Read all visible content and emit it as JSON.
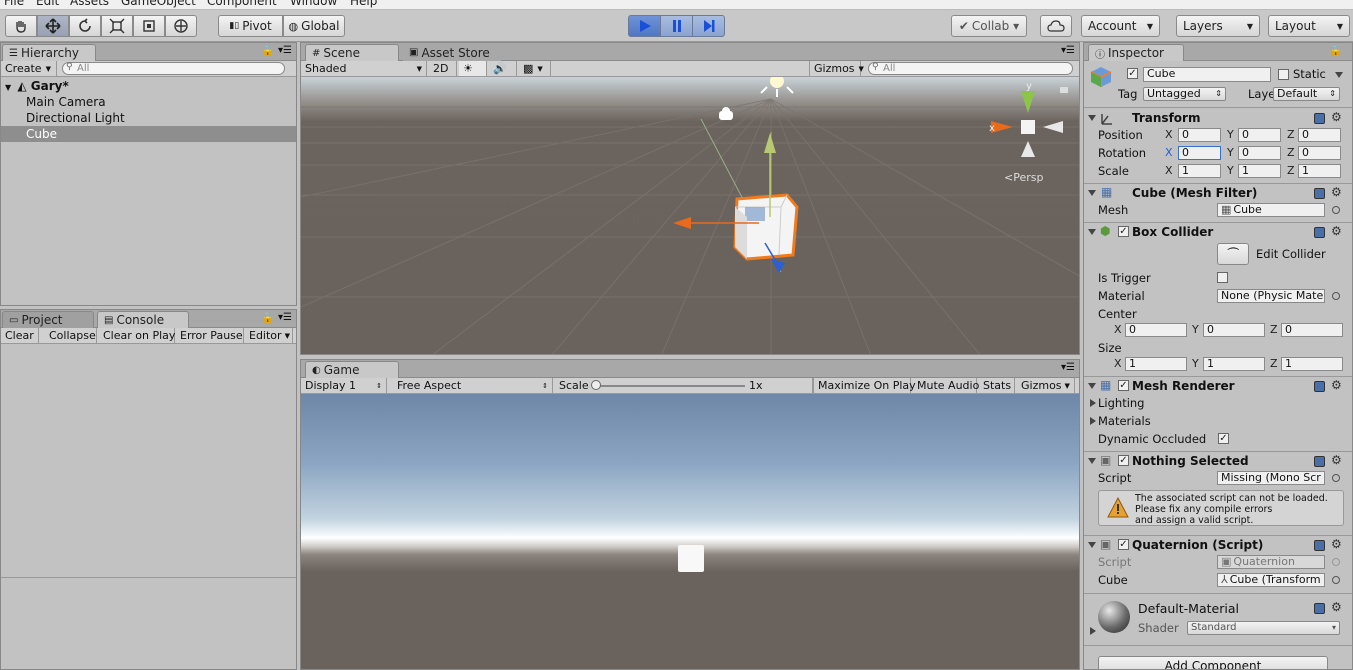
{
  "menu": [
    "File",
    "Edit",
    "Assets",
    "GameObject",
    "Component",
    "Window",
    "Help"
  ],
  "toolbar": {
    "pivot": "Pivot",
    "global": "Global",
    "collab": "Collab ▾",
    "account": "Account",
    "layers": "Layers",
    "layout": "Layout"
  },
  "hierarchy": {
    "tab": "Hierarchy",
    "create": "Create",
    "search_placeholder": "All",
    "scene": "Gary*",
    "items": [
      "Main Camera",
      "Directional Light",
      "Cube"
    ]
  },
  "scene": {
    "tab": "Scene",
    "asset_tab": "Asset Store",
    "shaded": "Shaded",
    "mode2d": "2D",
    "gizmos": "Gizmos",
    "search_placeholder": "All",
    "persp": "Persp",
    "axis_x": "x",
    "axis_y": "y"
  },
  "project": {
    "tab": "Project",
    "console_tab": "Console",
    "buttons": [
      "Clear",
      "Collapse",
      "Clear on Play",
      "Error Pause",
      "Editor"
    ]
  },
  "game": {
    "tab": "Game",
    "display": "Display 1",
    "aspect": "Free Aspect",
    "scale_label": "Scale",
    "scale_value": "1x",
    "maximize": "Maximize On Play",
    "mute": "Mute Audio",
    "stats": "Stats",
    "gizmos": "Gizmos"
  },
  "inspector": {
    "tab": "Inspector",
    "name": "Cube",
    "static": "Static",
    "tag_label": "Tag",
    "tag": "Untagged",
    "layer_label": "Layer",
    "layer": "Default",
    "transform": {
      "title": "Transform",
      "position_label": "Position",
      "rotation_label": "Rotation",
      "scale_label": "Scale",
      "position": [
        "0",
        "0",
        "0"
      ],
      "rotation": [
        "0",
        "0",
        "0"
      ],
      "scale": [
        "1",
        "1",
        "1"
      ]
    },
    "axes": [
      "X",
      "Y",
      "Z"
    ],
    "mesh_filter": {
      "title": "Cube (Mesh Filter)",
      "mesh_label": "Mesh",
      "mesh": "Cube"
    },
    "box_collider": {
      "title": "Box Collider",
      "edit": "Edit Collider",
      "trigger_label": "Is Trigger",
      "material_label": "Material",
      "material": "None (Physic Mate",
      "center_label": "Center",
      "size_label": "Size",
      "center": [
        "0",
        "0",
        "0"
      ],
      "size": [
        "1",
        "1",
        "1"
      ]
    },
    "mesh_renderer": {
      "title": "Mesh Renderer",
      "lighting": "Lighting",
      "materials": "Materials",
      "dynamic": "Dynamic Occluded"
    },
    "nothing": {
      "title": "Nothing Selected",
      "script_label": "Script",
      "script": "Missing (Mono Scr",
      "warning": "The associated script can not be loaded.\nPlease fix any compile errors\nand assign a valid script."
    },
    "quaternion": {
      "title": "Quaternion (Script)",
      "script_label": "Script",
      "script": "Quaternion",
      "cube_label": "Cube",
      "cube": "Cube (Transform"
    },
    "material": {
      "name": "Default-Material",
      "shader_label": "Shader",
      "shader": "Standard"
    },
    "add_component": "Add Component"
  }
}
